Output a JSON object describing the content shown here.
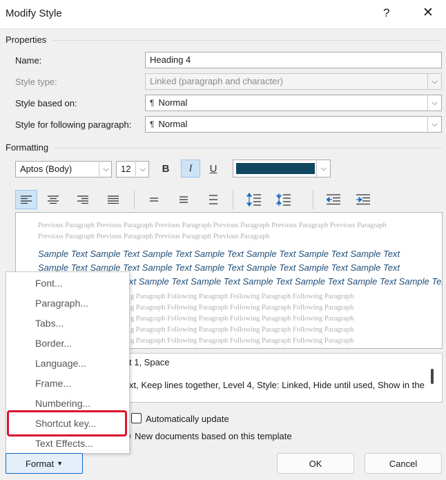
{
  "window": {
    "title": "Modify Style",
    "help": "?",
    "close": "✕"
  },
  "properties": {
    "section_label": "Properties",
    "name_label": "Name:",
    "name_value": "Heading 4",
    "style_type_label": "Style type:",
    "style_type_value": "Linked (paragraph and character)",
    "based_on_label": "Style based on:",
    "based_on_value": "Normal",
    "following_label": "Style for following paragraph:",
    "following_value": "Normal"
  },
  "formatting": {
    "section_label": "Formatting",
    "font_value": "Aptos (Body)",
    "size_value": "12",
    "bold_label": "B",
    "italic_label": "I",
    "underline_label": "U",
    "font_color": "#0f4761"
  },
  "preview": {
    "previous_text": "Previous Paragraph Previous Paragraph Previous Paragraph Previous Paragraph Previous Paragraph Previous Paragraph Previous Paragraph Previous Paragraph Previous Paragraph Previous Paragraph",
    "sample_line1": "Sample Text Sample Text Sample Text Sample Text Sample Text Sample Text Sample Text",
    "sample_line2": "Sample Text Sample Text Sample Text Sample Text Sample Text Sample Text Sample Text",
    "sample_line3": "xt Sample Text Sample Text Sample Text Sample Text Sample Text Sample Text",
    "following_lines": [
      "g Paragraph Following Paragraph Following Paragraph Following Paragraph",
      "g Paragraph Following Paragraph Following Paragraph Following Paragraph",
      "g Paragraph Following Paragraph Following Paragraph Following Paragraph",
      "g Paragraph Following Paragraph Following Paragraph Following Paragraph",
      "g Paragraph Following Paragraph Following Paragraph Following Paragraph"
    ]
  },
  "description": {
    "line1": "t 1, Space",
    "line2": "xt, Keep lines together, Level 4, Style: Linked, Hide until used, Show in the"
  },
  "options": {
    "auto_update_label": "Automatically update",
    "new_docs_label": "New documents based on this template"
  },
  "menu": {
    "items": [
      "Font...",
      "Paragraph...",
      "Tabs...",
      "Border...",
      "Language...",
      "Frame...",
      "Numbering...",
      "Shortcut key...",
      "Text Effects..."
    ]
  },
  "buttons": {
    "format_label": "Format",
    "ok_label": "OK",
    "cancel_label": "Cancel"
  },
  "colors": {
    "accent": "#0a64c8",
    "highlight": "#d9142a",
    "sample_text": "#1f4e79"
  }
}
